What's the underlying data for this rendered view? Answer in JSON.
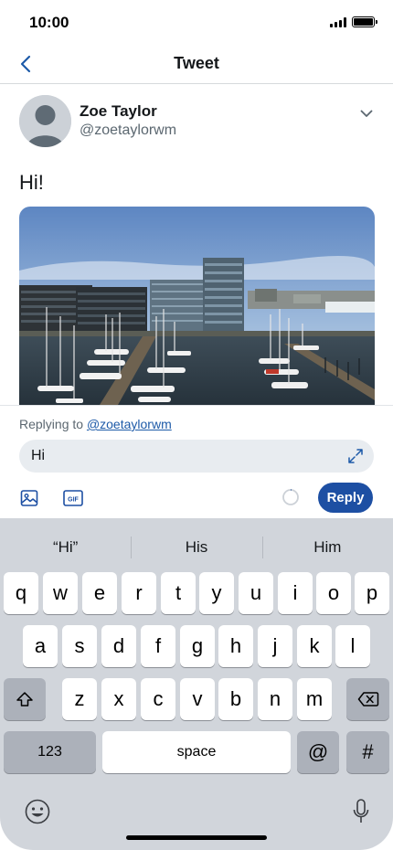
{
  "status_bar": {
    "time": "10:00"
  },
  "nav": {
    "title": "Tweet"
  },
  "tweet": {
    "display_name": "Zoe Taylor",
    "handle": "@zoetaylorwm",
    "text": "Hi!"
  },
  "reply": {
    "replying_prefix": "Replying to ",
    "replying_handle": "@zoetaylorwm",
    "input_value": "Hi",
    "gif_label": "GIF",
    "reply_label": "Reply"
  },
  "keyboard": {
    "suggestions": [
      "“Hi”",
      "His",
      "Him"
    ],
    "row1": [
      "q",
      "w",
      "e",
      "r",
      "t",
      "y",
      "u",
      "i",
      "o",
      "p"
    ],
    "row2": [
      "a",
      "s",
      "d",
      "f",
      "g",
      "h",
      "j",
      "k",
      "l"
    ],
    "row3": [
      "z",
      "x",
      "c",
      "v",
      "b",
      "n",
      "m"
    ],
    "numbers_label": "123",
    "space_label": "space",
    "at_label": "@",
    "hash_label": "#"
  },
  "colors": {
    "accent": "#1d4fa3",
    "link": "#1d5aa8",
    "input_bg": "#e8ecf0",
    "keyboard_bg": "#d1d5db"
  }
}
